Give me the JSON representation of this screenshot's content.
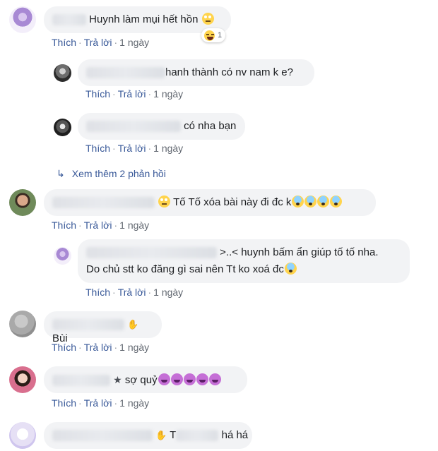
{
  "comments": [
    {
      "text": "Huynh làm mụi hết hồn",
      "reaction_count": "1",
      "actions": {
        "like": "Thích",
        "reply": "Trả lời",
        "time": "1 ngày"
      }
    },
    {
      "text": "hanh thành có nv nam k e?",
      "actions": {
        "like": "Thích",
        "reply": "Trả lời",
        "time": "1 ngày"
      }
    },
    {
      "text": "có nha bạn",
      "actions": {
        "like": "Thích",
        "reply": "Trả lời",
        "time": "1 ngày"
      }
    },
    {
      "more_replies": "Xem thêm 2 phản hồi"
    },
    {
      "text": "Tố Tố xóa bài này đi đc k",
      "actions": {
        "like": "Thích",
        "reply": "Trả lời",
        "time": "1 ngày"
      }
    },
    {
      "text_line1": ">..< huynh bấm ẩn giúp tố tố nha.",
      "text_line2": "Do chủ stt ko đăng gì sai nên Tt ko xoá đc",
      "actions": {
        "like": "Thích",
        "reply": "Trả lời",
        "time": "1 ngày"
      }
    },
    {
      "text": "Bùi",
      "actions": {
        "like": "Thích",
        "reply": "Trả lời",
        "time": "1 ngày"
      }
    },
    {
      "text": "sợ quỷ",
      "actions": {
        "like": "Thích",
        "reply": "Trả lời",
        "time": "1 ngày"
      }
    },
    {
      "text_tail": "há há",
      "partial_letter": "T"
    }
  ],
  "separator": "·",
  "colors": {
    "link": "#385898",
    "bubble": "#f2f3f5",
    "meta": "#616770"
  }
}
